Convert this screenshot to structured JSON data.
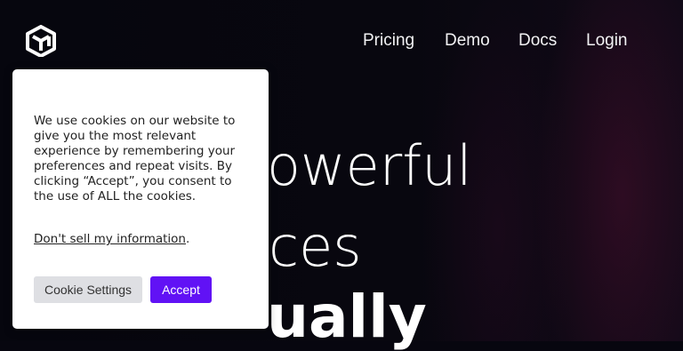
{
  "brand": {
    "logo_icon": "cube-logo-icon"
  },
  "nav": {
    "items": [
      "Pricing",
      "Demo",
      "Docs",
      "Login"
    ]
  },
  "hero": {
    "line1": "owerful",
    "line2": "ces",
    "line3": "ually"
  },
  "cookie_banner": {
    "text": "We use cookies on our website to give you the most relevant experience by remembering your preferences and repeat visits. By clicking “Accept”, you consent to the use of ALL the cookies.",
    "dont_sell_link": "Don't sell my information",
    "dont_sell_suffix": ".",
    "settings_button": "Cookie Settings",
    "accept_button": "Accept"
  },
  "colors": {
    "accent": "#6112f5",
    "background": "#07060f",
    "banner": "#ffffff"
  }
}
